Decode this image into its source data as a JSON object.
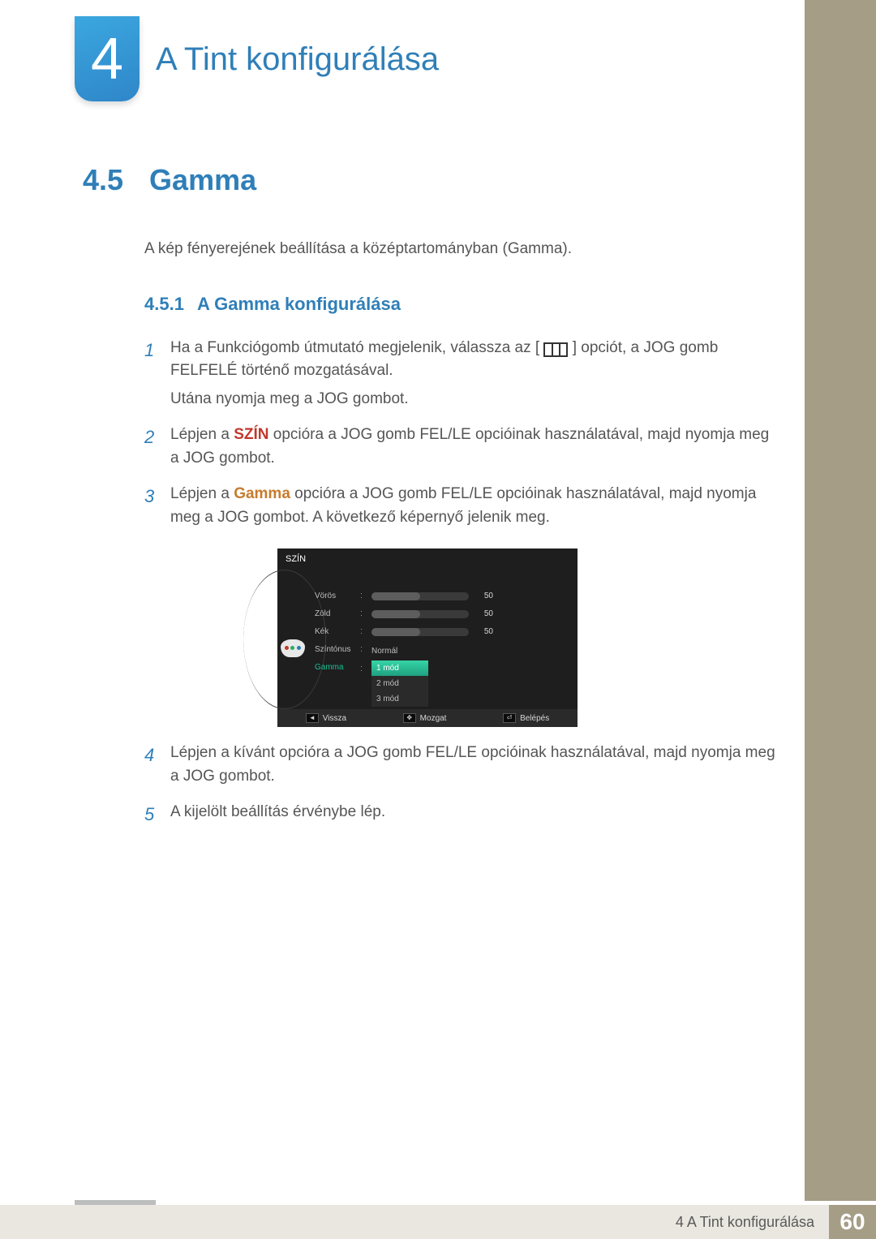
{
  "chapter": {
    "number": "4",
    "title": "A Tint konfigurálása"
  },
  "section": {
    "number": "4.5",
    "title": "Gamma",
    "intro": "A kép fényerejének beállítása a középtartományban (Gamma).",
    "sub": {
      "number": "4.5.1",
      "title": "A Gamma konfigurálása"
    }
  },
  "steps": {
    "s1a": "Ha a Funkciógomb útmutató megjelenik, válassza az [",
    "s1b": "] opciót, a JOG gomb FELFELÉ történő mozgatásával.",
    "s1c": "Utána nyomja meg a JOG gombot.",
    "s2a": "Lépjen a ",
    "s2_szin": "SZÍN",
    "s2b": " opcióra a JOG gomb FEL/LE opcióinak használatával, majd nyomja meg a JOG gombot.",
    "s3a": "Lépjen a ",
    "s3_gamma": "Gamma",
    "s3b": " opcióra a JOG gomb FEL/LE opcióinak használatával, majd nyomja meg a JOG gombot. A következő képernyő jelenik meg.",
    "s4": "Lépjen a kívánt opcióra a JOG gomb FEL/LE opcióinak használatával, majd nyomja meg a JOG gombot.",
    "s5": "A kijelölt beállítás érvénybe lép."
  },
  "osd": {
    "title": "SZÍN",
    "rows": {
      "red": {
        "label": "Vörös",
        "value": "50"
      },
      "green": {
        "label": "Zöld",
        "value": "50"
      },
      "blue": {
        "label": "Kék",
        "value": "50"
      },
      "tone": {
        "label": "Színtónus",
        "value": "Normál"
      },
      "gamma": {
        "label": "Gamma",
        "opt1": "1 mód",
        "opt2": "2 mód",
        "opt3": "3 mód"
      }
    },
    "footer": {
      "back": "Vissza",
      "move": "Mozgat",
      "enter": "Belépés"
    }
  },
  "footer": {
    "label": "4 A Tint konfigurálása",
    "page": "60"
  }
}
